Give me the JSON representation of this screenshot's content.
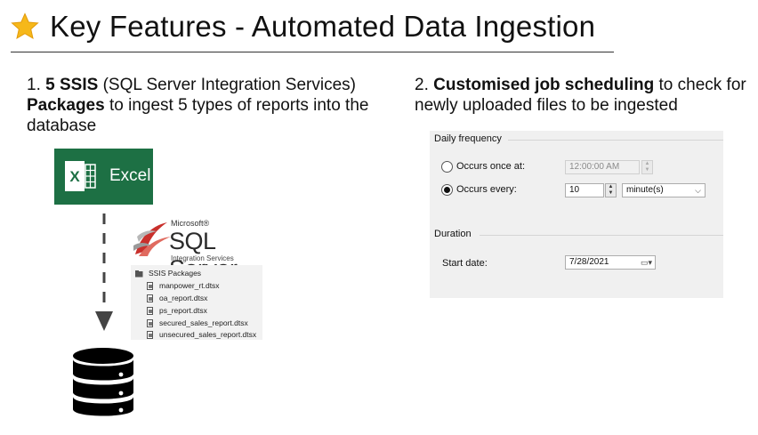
{
  "title": {
    "icon": "star-icon",
    "text": "Key Features - Automated Data Ingestion"
  },
  "feature1": {
    "number": "1.",
    "bold1": "5 SSIS",
    "text1": "(SQL Server Integration Services)",
    "bold2": "Packages",
    "text2": "to ingest 5 types of reports into the database"
  },
  "feature2": {
    "number": "2.",
    "bold1": "Customised job scheduling",
    "text1": "to check for newly uploaded files to be ingested"
  },
  "excel": {
    "icon": "excel-icon",
    "label": "Excel",
    "brand_color": "#1d7044"
  },
  "sql_logo": {
    "icon": "sql-server-icon",
    "microsoft": "Microsoft®",
    "product": "SQL Server",
    "subtitle": "Integration Services"
  },
  "ssis": {
    "folder_label": "SSIS Packages",
    "packages": [
      "manpower_rt.dtsx",
      "oa_report.dtsx",
      "ps_report.dtsx",
      "secured_sales_report.dtsx",
      "unsecured_sales_report.dtsx"
    ]
  },
  "database": {
    "icon": "database-icon"
  },
  "schedule": {
    "daily_frequency_label": "Daily frequency",
    "once_label": "Occurs once at:",
    "once_value": "12:00:00 AM",
    "every_label": "Occurs every:",
    "every_value": "10",
    "unit_value": "minute(s)",
    "selected_option": "Occurs every:",
    "duration_label": "Duration",
    "start_label": "Start date:",
    "start_value": "7/28/2021"
  }
}
